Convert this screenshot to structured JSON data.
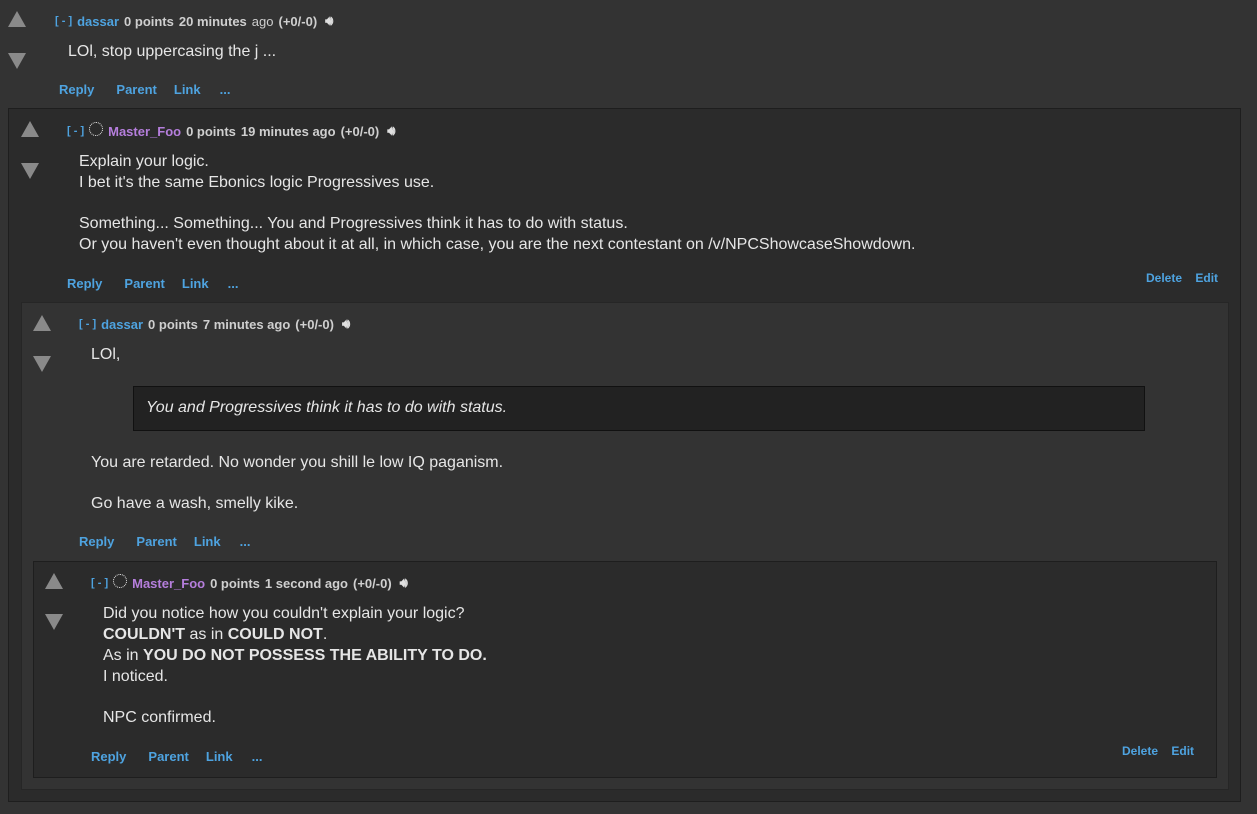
{
  "comments": [
    {
      "collapse": "[ - ]",
      "author": "dassar",
      "score": "0 points",
      "time": "20 minutes",
      "ago": "ago",
      "votes": "(+0/-0)",
      "lines": [
        "LOl, stop uppercasing the j ..."
      ],
      "actions": {
        "reply": "Reply",
        "parent": "Parent",
        "link": "Link",
        "more": "..."
      }
    },
    {
      "collapse": "[ - ]",
      "author": "Master_Foo",
      "score": "0 points",
      "time": "19 minutes ago",
      "votes": "(+0/-0)",
      "lines": [
        "Explain your logic.",
        "I bet it's the same Ebonics logic Progressives use.",
        "Something... Something... You and Progressives think it has to do with status.",
        "Or you haven't even thought about it at all, in which case, you are the next contestant on /v/NPCShowcaseShowdown."
      ],
      "actions": {
        "reply": "Reply",
        "parent": "Parent",
        "link": "Link",
        "more": "..."
      },
      "mod": {
        "delete": "Delete",
        "edit": "Edit"
      }
    },
    {
      "collapse": "[ - ]",
      "author": "dassar",
      "score": "0 points",
      "time": "7 minutes ago",
      "votes": "(+0/-0)",
      "lines": [
        "LOl,",
        "You are retarded. No wonder you shill le low IQ paganism.",
        "Go have a wash, smelly kike."
      ],
      "quote": "You and Progressives think it has to do with status.",
      "actions": {
        "reply": "Reply",
        "parent": "Parent",
        "link": "Link",
        "more": "..."
      }
    },
    {
      "collapse": "[ - ]",
      "author": "Master_Foo",
      "score": "0 points",
      "time": "1 second ago",
      "votes": "(+0/-0)",
      "lines": [
        "Did you notice how you couldn't explain your logic?",
        "COULDN'T",
        "as in",
        "COULD NOT",
        ".",
        "As in",
        "YOU DO NOT POSSESS THE ABILITY TO DO.",
        "I noticed.",
        "NPC confirmed."
      ],
      "actions": {
        "reply": "Reply",
        "parent": "Parent",
        "link": "Link",
        "more": "..."
      },
      "mod": {
        "delete": "Delete",
        "edit": "Edit"
      }
    }
  ],
  "icons": {
    "upvote": "upvote-arrow-icon",
    "downvote": "downvote-arrow-icon",
    "speaker": "speaker-icon",
    "avatar": "avatar-icon"
  },
  "colors": {
    "link": "#4ea3e0",
    "author_alt": "#b57edc",
    "background": "#333333",
    "nested_bg": "#2b2b2b"
  }
}
